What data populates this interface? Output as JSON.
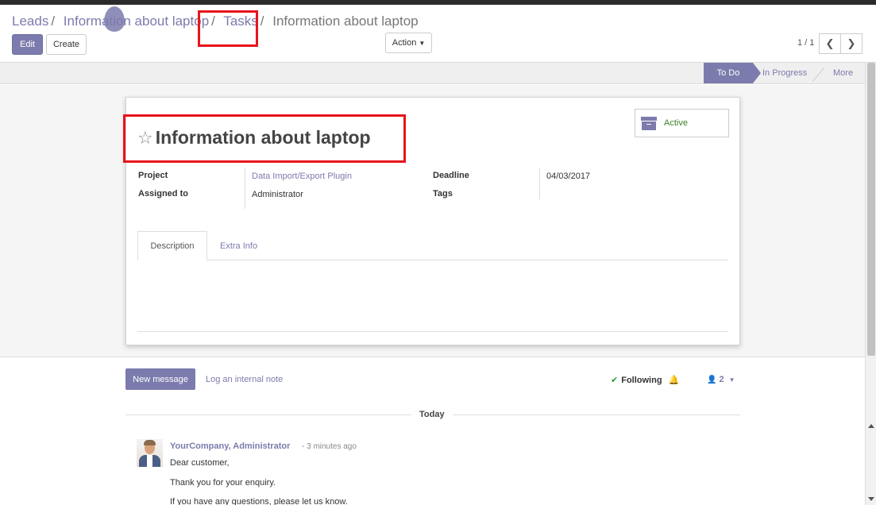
{
  "breadcrumb": {
    "items": [
      {
        "label": "Leads"
      },
      {
        "label": "Information about laptop"
      },
      {
        "label": "Tasks"
      },
      {
        "label": "Information about laptop"
      }
    ],
    "separator": "/"
  },
  "toolbar": {
    "edit_label": "Edit",
    "create_label": "Create",
    "action_label": "Action",
    "pager": "1 / 1"
  },
  "stages": {
    "active": "To Do",
    "next": "In Progress",
    "more": "More"
  },
  "record": {
    "active_label": "Active",
    "title": "Information about laptop",
    "fields": {
      "project_label": "Project",
      "project_value": "Data Import/Export Plugin",
      "assigned_label": "Assigned to",
      "assigned_value": "Administrator",
      "deadline_label": "Deadline",
      "deadline_value": "04/03/2017",
      "tags_label": "Tags"
    },
    "tabs": [
      {
        "label": "Description"
      },
      {
        "label": "Extra Info"
      }
    ]
  },
  "chatter": {
    "new_message": "New message",
    "log_note": "Log an internal note",
    "following": "Following",
    "followers_count": "2",
    "today": "Today",
    "message": {
      "author": "YourCompany, Administrator",
      "time": "- 3 minutes ago",
      "lines": [
        "Dear customer,",
        "Thank you for your enquiry.",
        "If you have any questions, please let us know."
      ]
    }
  },
  "colors": {
    "primary": "#7c7bad",
    "highlight": "#e8141c",
    "active_green": "#3b7f2a"
  }
}
